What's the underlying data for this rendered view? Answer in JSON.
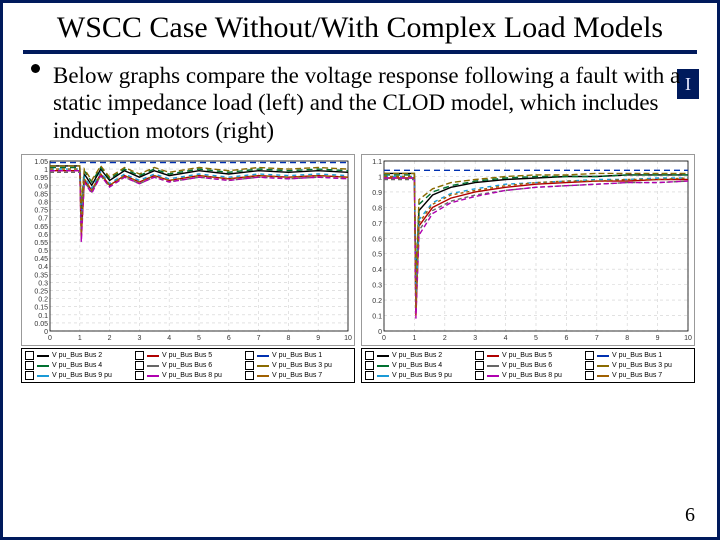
{
  "title": "WSCC Case Without/With Complex Load Models",
  "logo_letter": "I",
  "bullet": "Below graphs compare the voltage response following a fault with a static impedance load (left) and the CLOD model, which includes induction motors (right)",
  "page_number": "6",
  "chart_data": [
    {
      "type": "line",
      "title": "",
      "xlabel": "",
      "ylabel": "",
      "xlim": [
        0,
        10
      ],
      "ylim": [
        0,
        1.05
      ],
      "x_ticks": [
        0,
        1,
        2,
        3,
        4,
        5,
        6,
        7,
        8,
        9,
        10
      ],
      "y_ticks": [
        0,
        0.05,
        0.1,
        0.15,
        0.2,
        0.25,
        0.3,
        0.35,
        0.4,
        0.45,
        0.5,
        0.55,
        0.6,
        0.65,
        0.7,
        0.75,
        0.8,
        0.85,
        0.9,
        0.95,
        1,
        1.05
      ],
      "series": [
        {
          "name": "V pu_Bus Bus 2",
          "color": "#000000",
          "dash": "0",
          "x": [
            0,
            1.0,
            1.05,
            1.15,
            1.4,
            1.7,
            2.0,
            2.5,
            3.0,
            3.5,
            4.0,
            5.0,
            6.0,
            7.0,
            8.0,
            9.0,
            10.0
          ],
          "y": [
            1.02,
            1.02,
            0.7,
            0.97,
            0.9,
            1.0,
            0.93,
            0.99,
            0.95,
            0.99,
            0.96,
            0.99,
            0.97,
            0.99,
            0.98,
            0.99,
            0.98
          ]
        },
        {
          "name": "V pu_Bus Bus 5",
          "color": "#b00000",
          "dash": "0",
          "x": [
            0,
            1.0,
            1.05,
            1.15,
            1.4,
            1.7,
            2.0,
            2.5,
            3.0,
            3.5,
            4.0,
            5.0,
            6.0,
            7.0,
            8.0,
            9.0,
            10.0
          ],
          "y": [
            0.99,
            0.99,
            0.58,
            0.93,
            0.87,
            0.97,
            0.9,
            0.96,
            0.92,
            0.96,
            0.93,
            0.96,
            0.94,
            0.96,
            0.95,
            0.96,
            0.95
          ]
        },
        {
          "name": "V pu_Bus Bus 1",
          "color": "#0030b0",
          "dash": "6 4",
          "x": [
            0,
            1.0,
            1.05,
            1.15,
            1.4,
            1.7,
            2.0,
            2.5,
            3.0,
            3.5,
            4.0,
            5.0,
            6.0,
            7.0,
            8.0,
            9.0,
            10.0
          ],
          "y": [
            1.04,
            1.04,
            1.04,
            1.04,
            1.04,
            1.04,
            1.04,
            1.04,
            1.04,
            1.04,
            1.04,
            1.04,
            1.04,
            1.04,
            1.04,
            1.04,
            1.04
          ]
        },
        {
          "name": "V pu_Bus Bus 4",
          "color": "#007030",
          "dash": "6 4",
          "x": [
            0,
            1.0,
            1.05,
            1.15,
            1.4,
            1.7,
            2.0,
            2.5,
            3.0,
            3.5,
            4.0,
            5.0,
            6.0,
            7.0,
            8.0,
            9.0,
            10.0
          ],
          "y": [
            1.01,
            1.01,
            0.75,
            0.99,
            0.92,
            1.01,
            0.94,
            1.0,
            0.96,
            1.0,
            0.97,
            1.0,
            0.98,
            1.0,
            0.99,
            1.0,
            0.99
          ]
        },
        {
          "name": "V pu_Bus Bus 6",
          "color": "#666666",
          "dash": "4 3",
          "x": [
            0,
            1.0,
            1.05,
            1.15,
            1.4,
            1.7,
            2.0,
            2.5,
            3.0,
            3.5,
            4.0,
            5.0,
            6.0,
            7.0,
            8.0,
            9.0,
            10.0
          ],
          "y": [
            0.98,
            0.98,
            0.62,
            0.92,
            0.86,
            0.96,
            0.89,
            0.95,
            0.91,
            0.95,
            0.92,
            0.95,
            0.93,
            0.95,
            0.94,
            0.95,
            0.94
          ]
        },
        {
          "name": "V pu_Bus Bus 3 pu",
          "color": "#8a6a00",
          "dash": "6 3",
          "x": [
            0,
            1.0,
            1.05,
            1.15,
            1.4,
            1.7,
            2.0,
            2.5,
            3.0,
            3.5,
            4.0,
            5.0,
            6.0,
            7.0,
            8.0,
            9.0,
            10.0
          ],
          "y": [
            1.02,
            1.02,
            0.78,
            1.0,
            0.93,
            1.02,
            0.95,
            1.01,
            0.97,
            1.01,
            0.98,
            1.01,
            0.99,
            1.01,
            1.0,
            1.01,
            1.0
          ]
        },
        {
          "name": "V pu_Bus Bus 9 pu",
          "color": "#1a9ad6",
          "dash": "4 4",
          "x": [
            0,
            1.0,
            1.05,
            1.15,
            1.4,
            1.7,
            2.0,
            2.5,
            3.0,
            3.5,
            4.0,
            5.0,
            6.0,
            7.0,
            8.0,
            9.0,
            10.0
          ],
          "y": [
            1.0,
            1.0,
            0.66,
            0.95,
            0.88,
            0.98,
            0.91,
            0.97,
            0.93,
            0.97,
            0.94,
            0.97,
            0.95,
            0.97,
            0.96,
            0.97,
            0.96
          ]
        },
        {
          "name": "V pu_Bus Bus 8 pu",
          "color": "#b000b0",
          "dash": "5 3",
          "x": [
            0,
            1.0,
            1.05,
            1.15,
            1.4,
            1.7,
            2.0,
            2.5,
            3.0,
            3.5,
            4.0,
            5.0,
            6.0,
            7.0,
            8.0,
            9.0,
            10.0
          ],
          "y": [
            0.99,
            0.99,
            0.55,
            0.92,
            0.85,
            0.96,
            0.89,
            0.95,
            0.91,
            0.95,
            0.92,
            0.95,
            0.93,
            0.95,
            0.94,
            0.95,
            0.94
          ]
        },
        {
          "name": "V pu_Bus Bus 7",
          "color": "#a06000",
          "dash": "3 3",
          "x": [
            0,
            1.0,
            1.05,
            1.15,
            1.4,
            1.7,
            2.0,
            2.5,
            3.0,
            3.5,
            4.0,
            5.0,
            6.0,
            7.0,
            8.0,
            9.0,
            10.0
          ],
          "y": [
            1.0,
            1.0,
            0.6,
            0.94,
            0.87,
            0.97,
            0.9,
            0.96,
            0.92,
            0.96,
            0.93,
            0.96,
            0.94,
            0.96,
            0.95,
            0.96,
            0.95
          ]
        }
      ]
    },
    {
      "type": "line",
      "title": "",
      "xlabel": "",
      "ylabel": "",
      "xlim": [
        0,
        10
      ],
      "ylim": [
        0,
        1.1
      ],
      "x_ticks": [
        0,
        1,
        2,
        3,
        4,
        5,
        6,
        7,
        8,
        9,
        10
      ],
      "y_ticks": [
        0,
        0.1,
        0.2,
        0.3,
        0.4,
        0.5,
        0.6,
        0.7,
        0.8,
        0.9,
        1,
        1.1
      ],
      "series": [
        {
          "name": "V pu_Bus Bus 2",
          "color": "#000000",
          "dash": "0",
          "x": [
            0,
            1.0,
            1.05,
            1.15,
            1.6,
            2.2,
            3.0,
            4.0,
            5.0,
            6.0,
            7.0,
            8.0,
            9.0,
            10.0
          ],
          "y": [
            1.02,
            1.02,
            0.2,
            0.78,
            0.88,
            0.93,
            0.96,
            0.98,
            0.99,
            1.0,
            1.0,
            1.01,
            1.01,
            1.01
          ]
        },
        {
          "name": "V pu_Bus Bus 5",
          "color": "#b00000",
          "dash": "0",
          "x": [
            0,
            1.0,
            1.05,
            1.15,
            1.6,
            2.2,
            3.0,
            4.0,
            5.0,
            6.0,
            7.0,
            8.0,
            9.0,
            10.0
          ],
          "y": [
            0.99,
            0.99,
            0.1,
            0.68,
            0.8,
            0.86,
            0.9,
            0.93,
            0.95,
            0.96,
            0.97,
            0.97,
            0.98,
            0.98
          ]
        },
        {
          "name": "V pu_Bus Bus 1",
          "color": "#0030b0",
          "dash": "6 4",
          "x": [
            0,
            1.0,
            1.05,
            1.15,
            1.6,
            2.2,
            3.0,
            4.0,
            5.0,
            6.0,
            7.0,
            8.0,
            9.0,
            10.0
          ],
          "y": [
            1.04,
            1.04,
            1.04,
            1.04,
            1.04,
            1.04,
            1.04,
            1.04,
            1.04,
            1.04,
            1.04,
            1.04,
            1.04,
            1.04
          ]
        },
        {
          "name": "V pu_Bus Bus 4",
          "color": "#007030",
          "dash": "6 4",
          "x": [
            0,
            1.0,
            1.05,
            1.15,
            1.6,
            2.2,
            3.0,
            4.0,
            5.0,
            6.0,
            7.0,
            8.0,
            9.0,
            10.0
          ],
          "y": [
            1.01,
            1.01,
            0.3,
            0.82,
            0.9,
            0.94,
            0.97,
            0.99,
            1.0,
            1.0,
            1.0,
            1.01,
            1.01,
            1.01
          ]
        },
        {
          "name": "V pu_Bus Bus 6",
          "color": "#666666",
          "dash": "4 3",
          "x": [
            0,
            1.0,
            1.05,
            1.15,
            1.6,
            2.2,
            3.0,
            4.0,
            5.0,
            6.0,
            7.0,
            8.0,
            9.0,
            10.0
          ],
          "y": [
            0.98,
            0.98,
            0.13,
            0.65,
            0.78,
            0.84,
            0.88,
            0.91,
            0.93,
            0.94,
            0.95,
            0.96,
            0.96,
            0.97
          ]
        },
        {
          "name": "V pu_Bus Bus 3 pu",
          "color": "#8a6a00",
          "dash": "6 3",
          "x": [
            0,
            1.0,
            1.05,
            1.15,
            1.6,
            2.2,
            3.0,
            4.0,
            5.0,
            6.0,
            7.0,
            8.0,
            9.0,
            10.0
          ],
          "y": [
            1.02,
            1.02,
            0.35,
            0.85,
            0.92,
            0.96,
            0.98,
            1.0,
            1.01,
            1.01,
            1.02,
            1.02,
            1.02,
            1.02
          ]
        },
        {
          "name": "V pu_Bus Bus 9 pu",
          "color": "#1a9ad6",
          "dash": "4 4",
          "x": [
            0,
            1.0,
            1.05,
            1.15,
            1.6,
            2.2,
            3.0,
            4.0,
            5.0,
            6.0,
            7.0,
            8.0,
            9.0,
            10.0
          ],
          "y": [
            1.0,
            1.0,
            0.18,
            0.72,
            0.83,
            0.89,
            0.92,
            0.95,
            0.96,
            0.97,
            0.98,
            0.98,
            0.99,
            0.99
          ]
        },
        {
          "name": "V pu_Bus Bus 8 pu",
          "color": "#b000b0",
          "dash": "5 3",
          "x": [
            0,
            1.0,
            1.05,
            1.15,
            1.6,
            2.2,
            3.0,
            4.0,
            5.0,
            6.0,
            7.0,
            8.0,
            9.0,
            10.0
          ],
          "y": [
            0.99,
            0.99,
            0.08,
            0.62,
            0.76,
            0.83,
            0.87,
            0.91,
            0.93,
            0.94,
            0.95,
            0.96,
            0.96,
            0.97
          ]
        },
        {
          "name": "V pu_Bus Bus 7",
          "color": "#a06000",
          "dash": "3 3",
          "x": [
            0,
            1.0,
            1.05,
            1.15,
            1.6,
            2.2,
            3.0,
            4.0,
            5.0,
            6.0,
            7.0,
            8.0,
            9.0,
            10.0
          ],
          "y": [
            1.0,
            1.0,
            0.15,
            0.7,
            0.82,
            0.88,
            0.91,
            0.94,
            0.96,
            0.97,
            0.97,
            0.98,
            0.98,
            0.99
          ]
        }
      ]
    }
  ]
}
